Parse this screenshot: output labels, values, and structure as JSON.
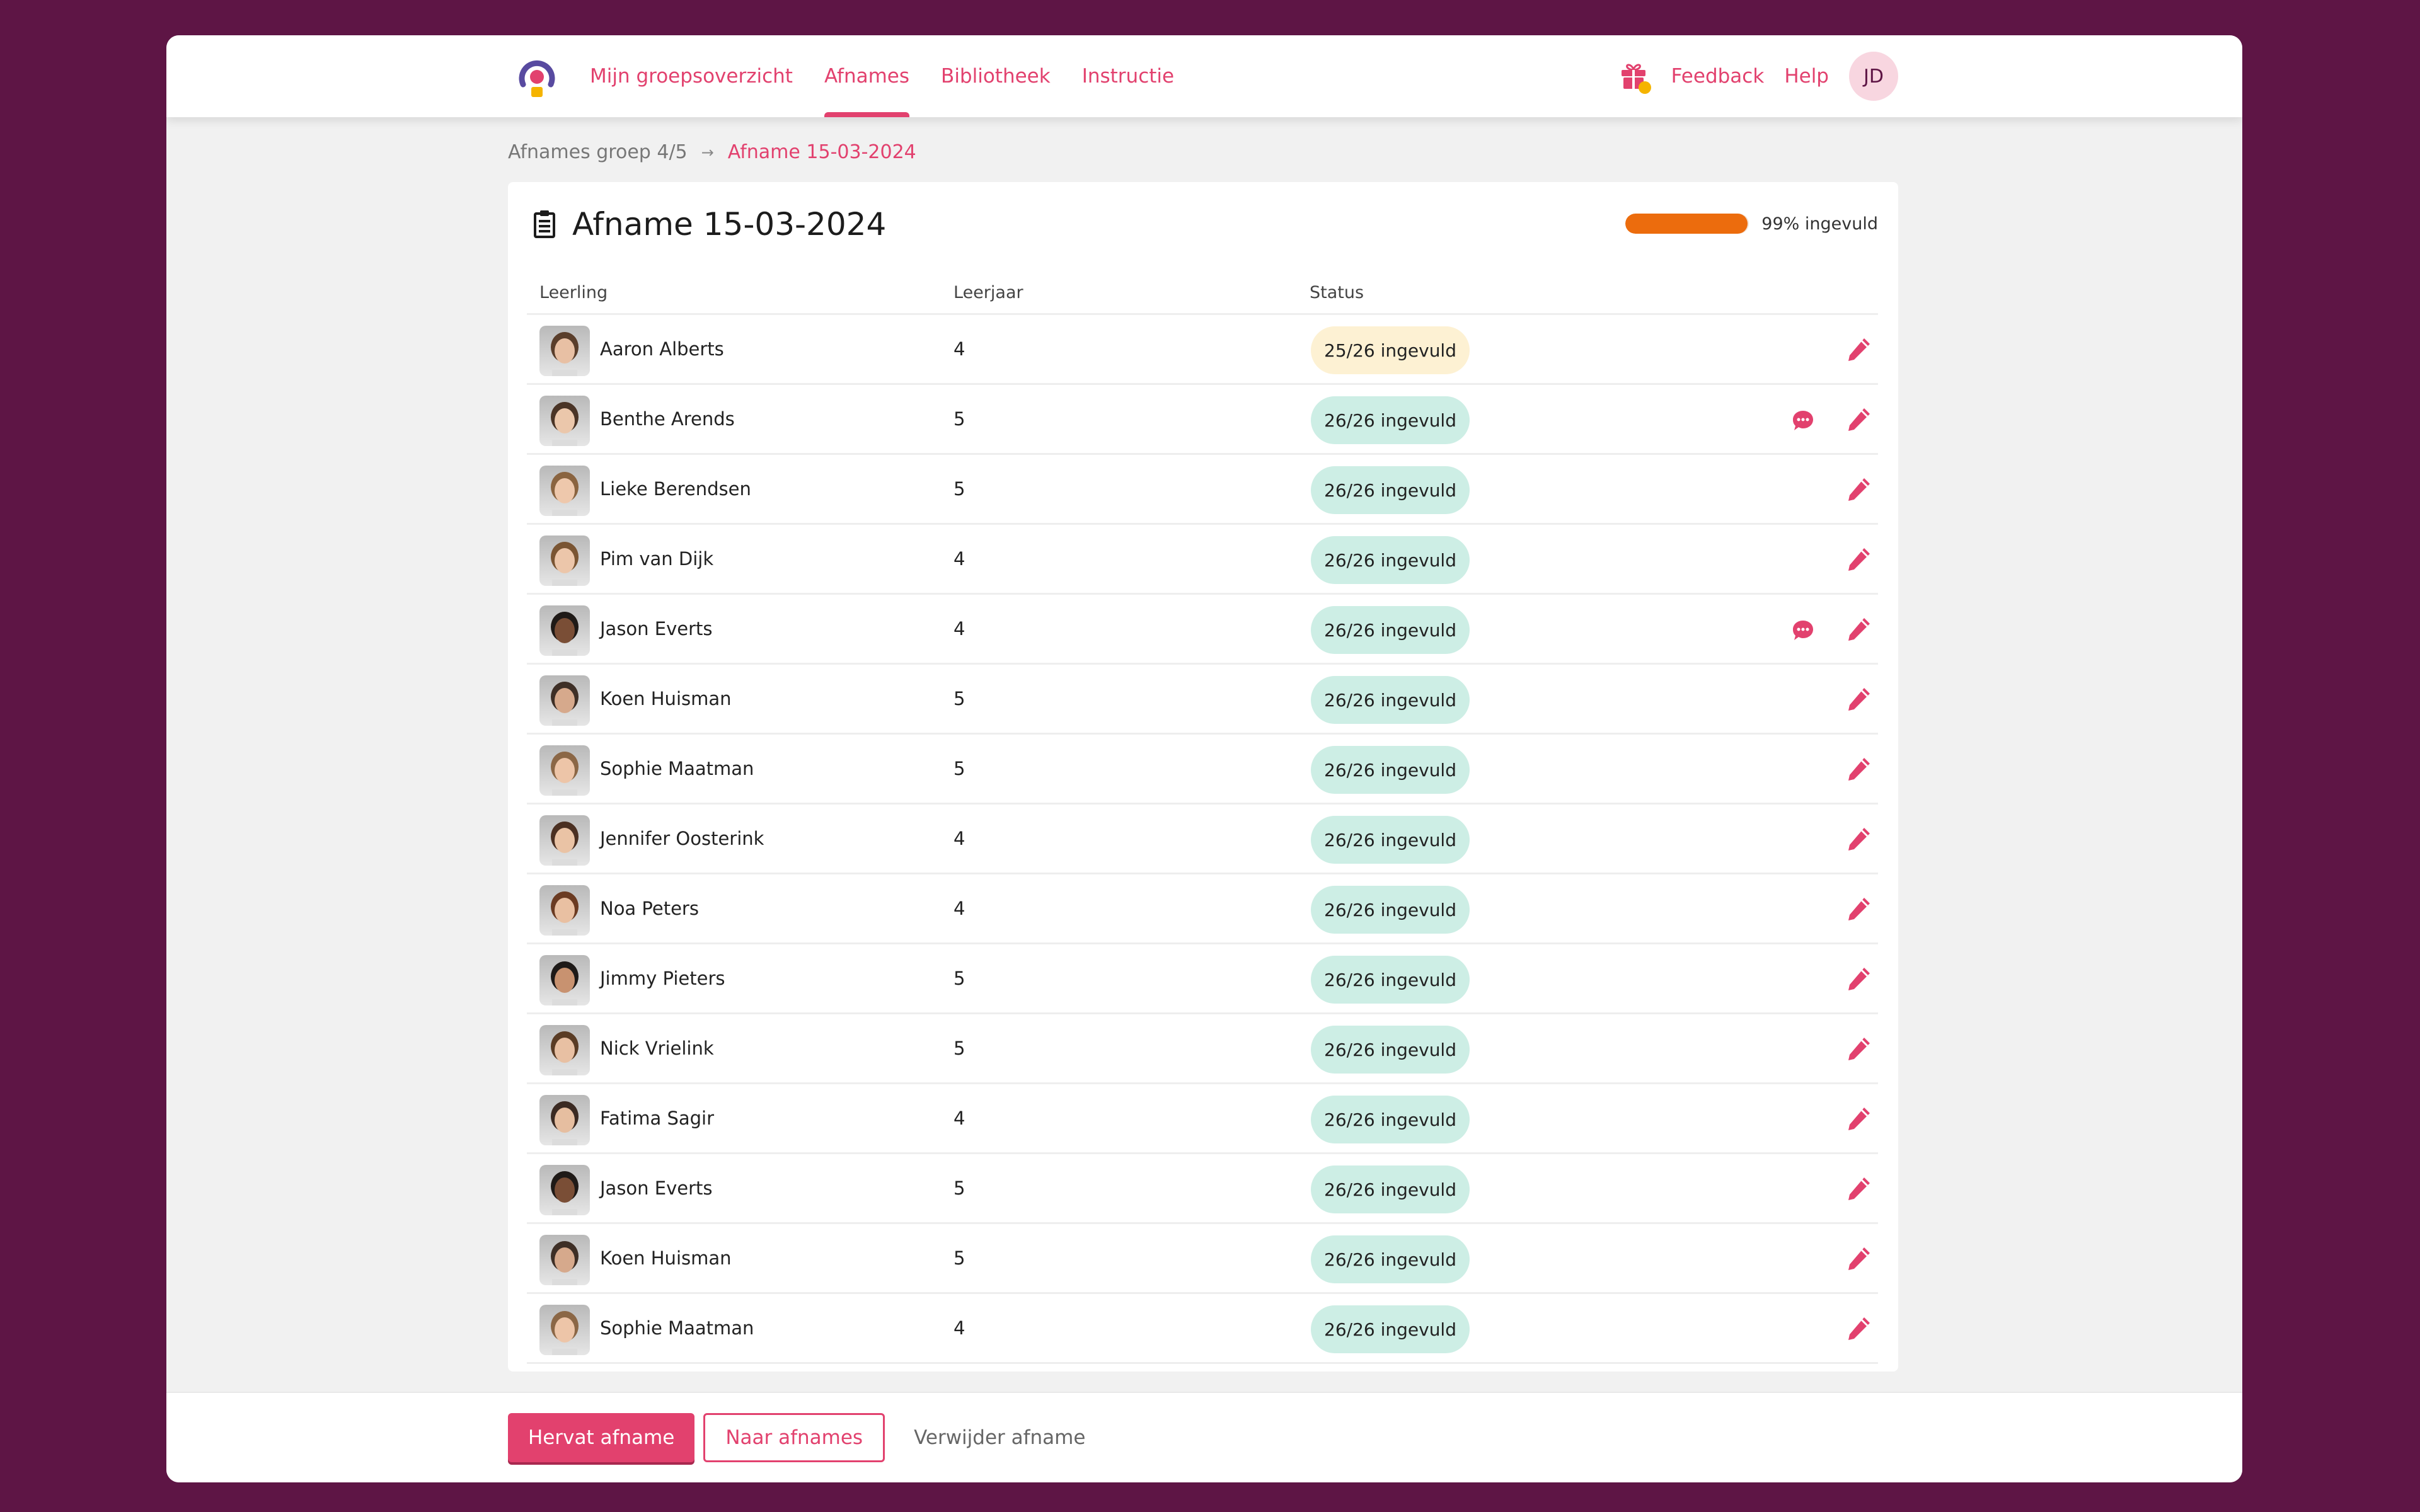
{
  "nav": {
    "logo": "kijk-logo-icon",
    "items": [
      {
        "label": "Mijn groepsoverzicht",
        "active": false
      },
      {
        "label": "Afnames",
        "active": true
      },
      {
        "label": "Bibliotheek",
        "active": false
      },
      {
        "label": "Instructie",
        "active": false
      }
    ],
    "gift_icon": "gift-icon",
    "feedback_label": "Feedback",
    "help_label": "Help",
    "user_initials": "JD"
  },
  "breadcrumb": {
    "parent": "Afnames groep 4/5",
    "separator": "→",
    "current": "Afname 15-03-2024"
  },
  "card": {
    "icon": "clipboard-icon",
    "title": "Afname 15-03-2024",
    "progress_percent": 99,
    "progress_label": "99% ingevuld"
  },
  "table": {
    "columns": [
      "Leerling",
      "Leerjaar",
      "Status"
    ],
    "rows": [
      {
        "name": "Aaron Alberts",
        "year": "4",
        "status": "25/26 ingevuld",
        "complete": false,
        "comment": false
      },
      {
        "name": "Benthe Arends",
        "year": "5",
        "status": "26/26 ingevuld",
        "complete": true,
        "comment": true
      },
      {
        "name": "Lieke Berendsen",
        "year": "5",
        "status": "26/26 ingevuld",
        "complete": true,
        "comment": false
      },
      {
        "name": "Pim van Dijk",
        "year": "4",
        "status": "26/26 ingevuld",
        "complete": true,
        "comment": false
      },
      {
        "name": "Jason Everts",
        "year": "4",
        "status": "26/26 ingevuld",
        "complete": true,
        "comment": true
      },
      {
        "name": "Koen Huisman",
        "year": "5",
        "status": "26/26 ingevuld",
        "complete": true,
        "comment": false
      },
      {
        "name": "Sophie Maatman",
        "year": "5",
        "status": "26/26 ingevuld",
        "complete": true,
        "comment": false
      },
      {
        "name": "Jennifer Oosterink",
        "year": "4",
        "status": "26/26 ingevuld",
        "complete": true,
        "comment": false
      },
      {
        "name": "Noa Peters",
        "year": "4",
        "status": "26/26 ingevuld",
        "complete": true,
        "comment": false
      },
      {
        "name": "Jimmy Pieters",
        "year": "5",
        "status": "26/26 ingevuld",
        "complete": true,
        "comment": false
      },
      {
        "name": "Nick Vrielink",
        "year": "5",
        "status": "26/26 ingevuld",
        "complete": true,
        "comment": false
      },
      {
        "name": "Fatima Sagir",
        "year": "4",
        "status": "26/26 ingevuld",
        "complete": true,
        "comment": false
      },
      {
        "name": "Jason Everts",
        "year": "5",
        "status": "26/26 ingevuld",
        "complete": true,
        "comment": false
      },
      {
        "name": "Koen Huisman",
        "year": "5",
        "status": "26/26 ingevuld",
        "complete": true,
        "comment": false
      },
      {
        "name": "Sophie Maatman",
        "year": "4",
        "status": "26/26 ingevuld",
        "complete": true,
        "comment": false
      }
    ]
  },
  "footer": {
    "primary_label": "Hervat afname",
    "secondary_label": "Naar afnames",
    "tertiary_label": "Verwijder afname"
  },
  "colors": {
    "brand": "#e2416e",
    "background": "#5e1545",
    "progress": "#ec6c0d",
    "status_complete": "#cdeee5",
    "status_partial": "#fdf1d3"
  }
}
